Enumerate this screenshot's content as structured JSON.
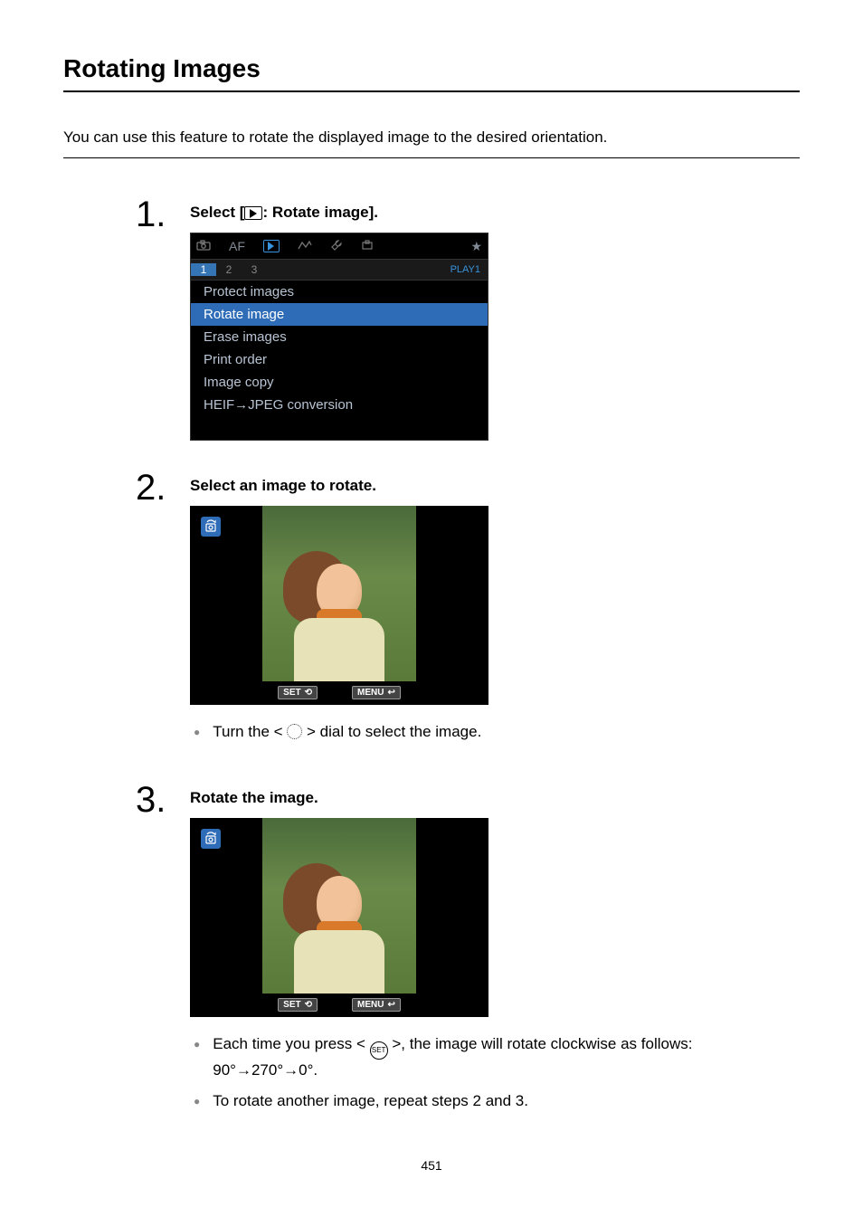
{
  "title": "Rotating Images",
  "intro": "You can use this feature to rotate the displayed image to the desired orientation.",
  "steps": {
    "s1": {
      "num": "1",
      "title_pre": "Select [",
      "title_post": ": Rotate image].",
      "menu": {
        "tabs_top": {
          "af": "AF"
        },
        "subtabs": {
          "t1": "1",
          "t2": "2",
          "t3": "3",
          "label": "PLAY1"
        },
        "items": {
          "i1": "Protect images",
          "i2": "Rotate image",
          "i3": "Erase images",
          "i4": "Print order",
          "i5": "Image copy",
          "i6": "HEIF→JPEG conversion"
        }
      }
    },
    "s2": {
      "num": "2",
      "title": "Select an image to rotate.",
      "buttons": {
        "set": "SET",
        "menu": "MENU"
      },
      "bullet": {
        "pre": "Turn the < ",
        "post": " > dial to select the image."
      }
    },
    "s3": {
      "num": "3",
      "title": "Rotate the image.",
      "buttons": {
        "set": "SET",
        "menu": "MENU"
      },
      "bullet1": {
        "pre": "Each time you press < ",
        "post": " >, the image will rotate clockwise as follows: 90°→270°→0°.",
        "set_label": "SET"
      },
      "bullet2": "To rotate another image, repeat steps 2 and 3."
    }
  },
  "page_number": "451"
}
